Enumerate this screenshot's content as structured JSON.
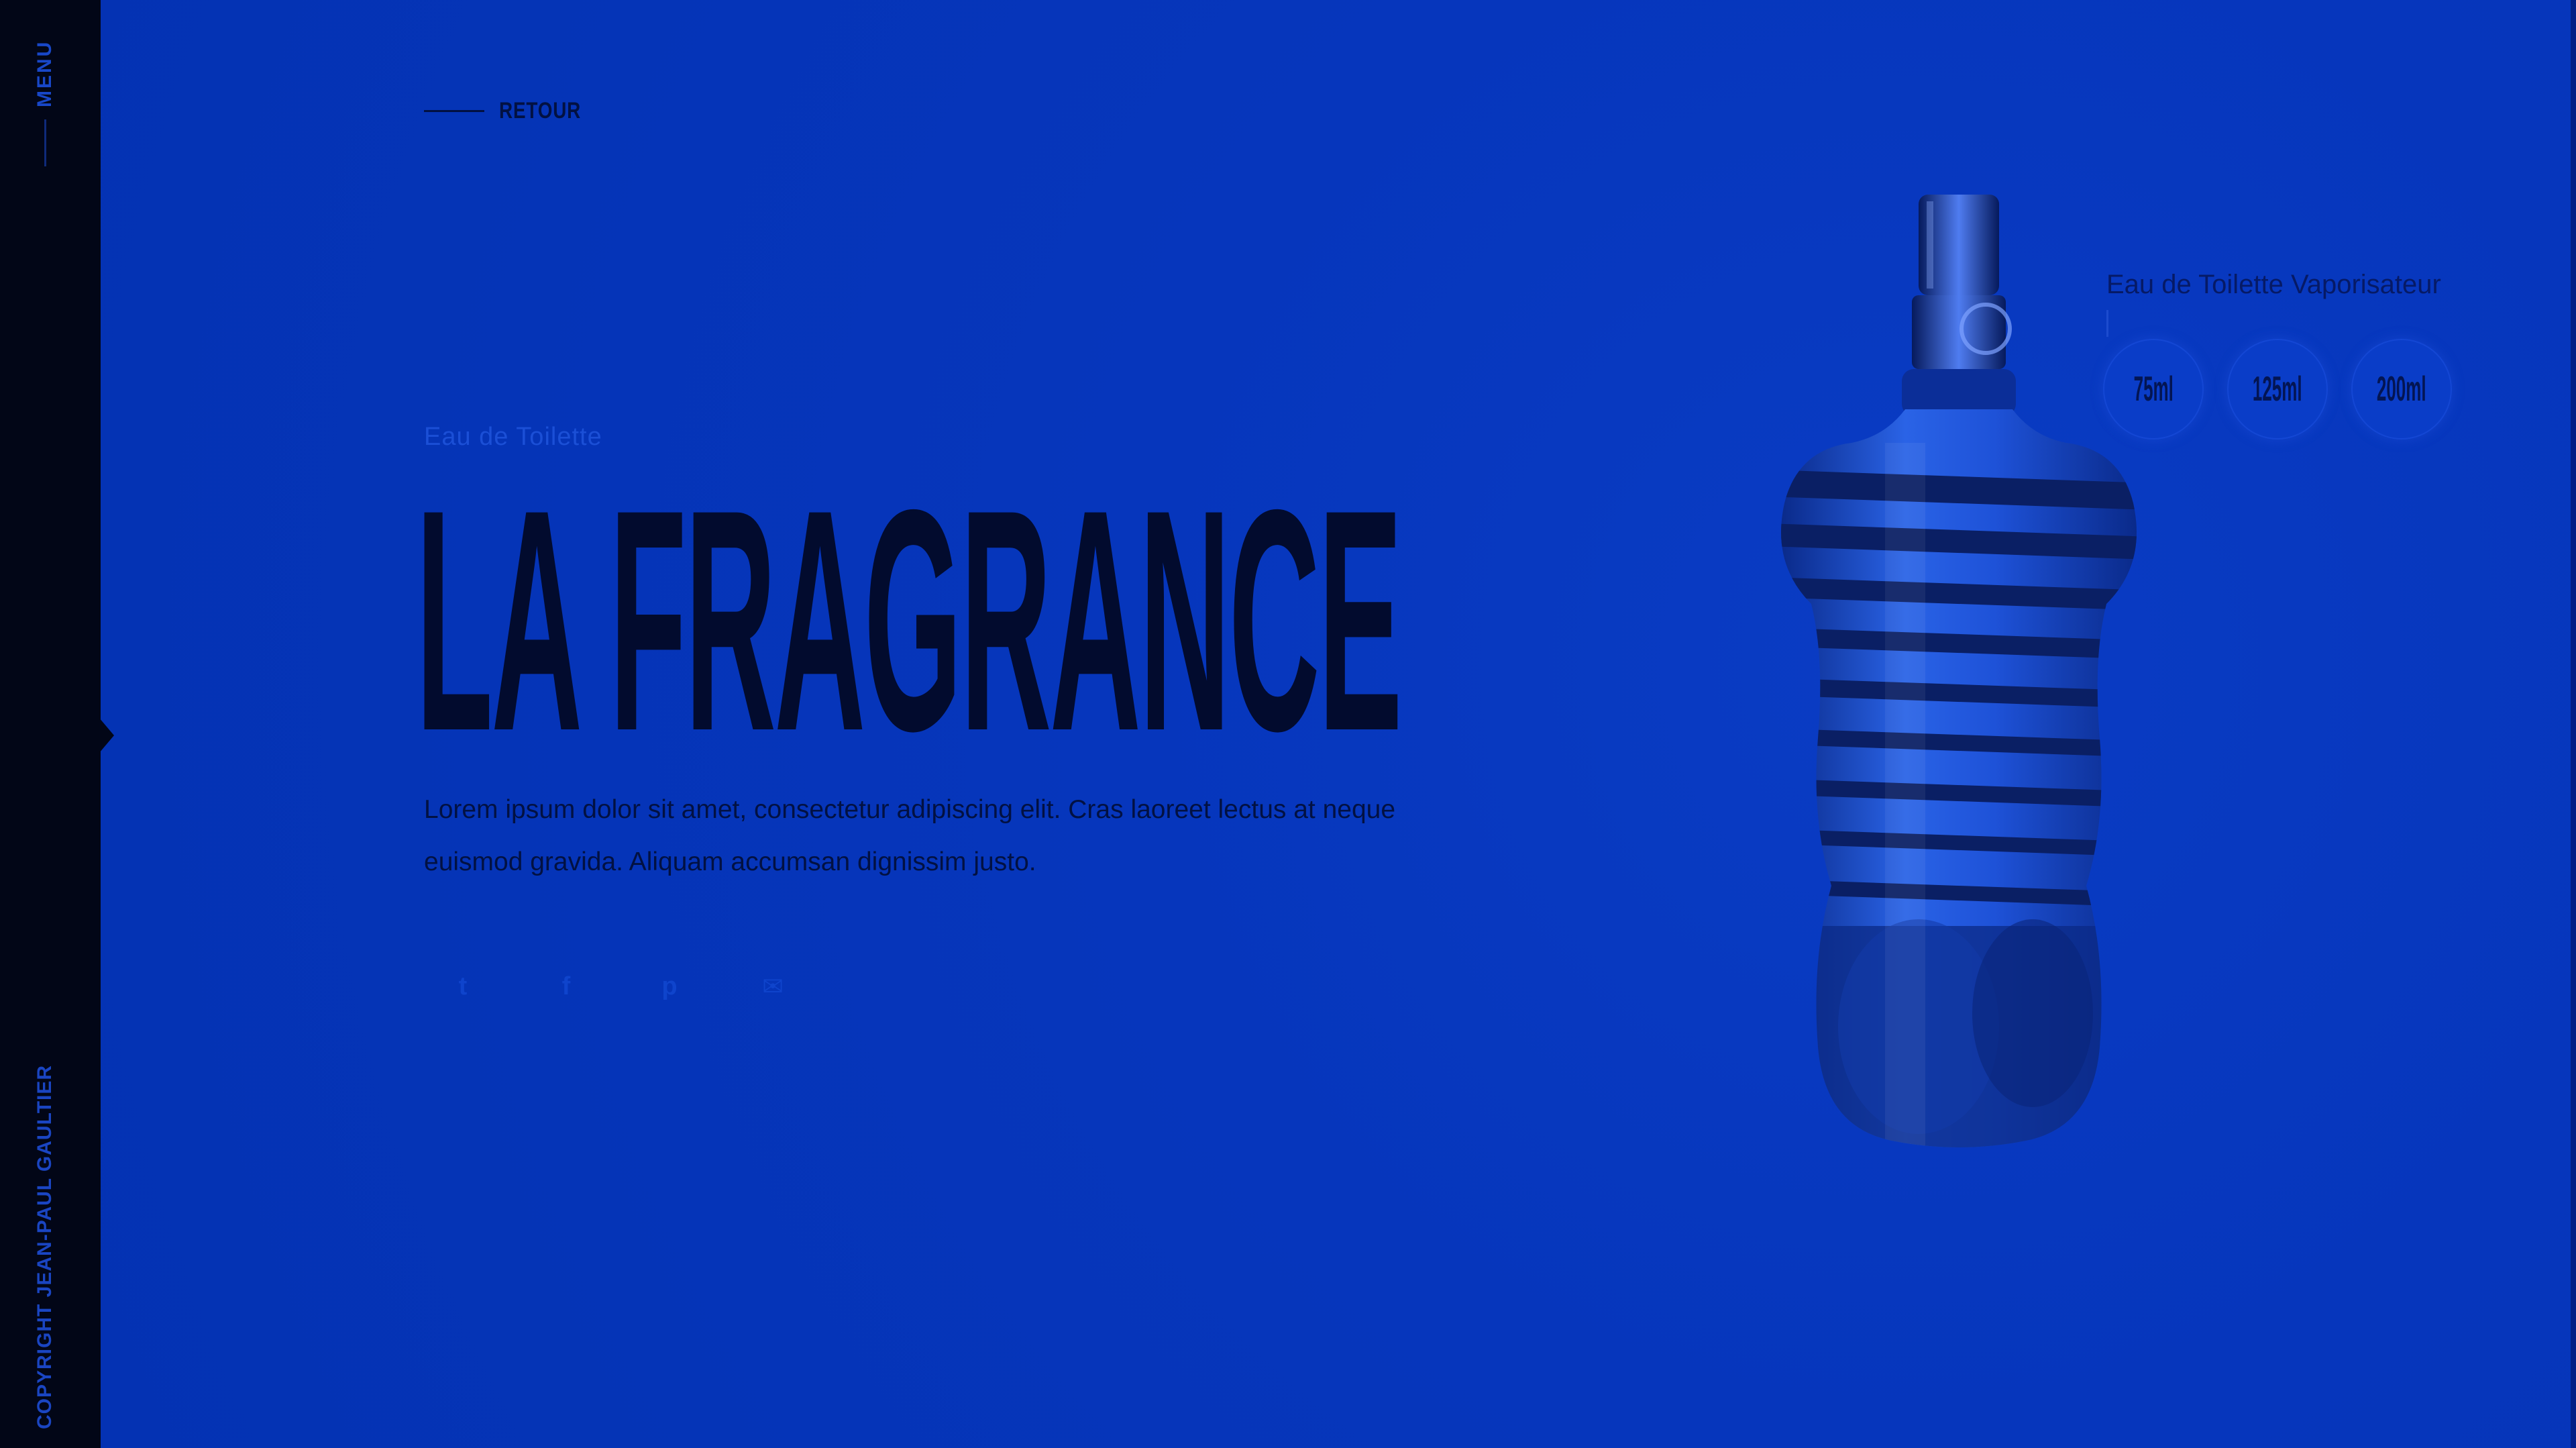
{
  "rail": {
    "menu_label": "MENU",
    "copyright": "COPYRIGHT JEAN-PAUL GAULTIER"
  },
  "back": {
    "label": "RETOUR"
  },
  "hero": {
    "kicker": "Eau de Toilette",
    "title": "LA FRAGRANCE",
    "description": "Lorem ipsum dolor sit amet, consectetur adipiscing elit. Cras laoreet lectus at neque euismod gravida. Aliquam accumsan dignissim justo."
  },
  "share": [
    {
      "icon": "twitter-icon",
      "glyph": "t"
    },
    {
      "icon": "facebook-icon",
      "glyph": "f"
    },
    {
      "icon": "pinterest-icon",
      "glyph": "p"
    },
    {
      "icon": "email-icon",
      "glyph": "✉"
    }
  ],
  "product": {
    "image": "perfume-bottle-striped-torso"
  },
  "sizes": {
    "title": "Eau de Toilette Vaporisateur",
    "options": [
      "75ml",
      "125ml",
      "200ml"
    ]
  },
  "colors": {
    "background": "#0534b8",
    "rail": "#020617",
    "title": "#020b2e"
  }
}
